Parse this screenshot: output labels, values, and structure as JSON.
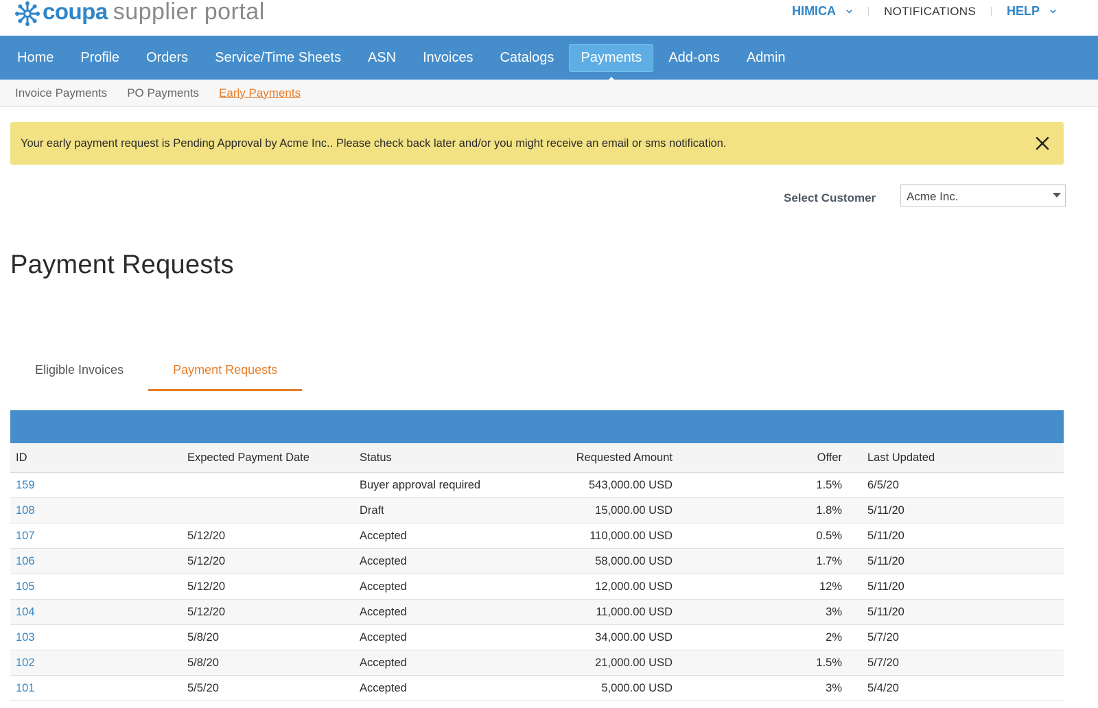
{
  "header": {
    "logo_brand": "coupa",
    "logo_product": "supplier portal",
    "user_menu": "HIMICA",
    "notifications": "NOTIFICATIONS",
    "help": "HELP"
  },
  "nav": {
    "items": [
      "Home",
      "Profile",
      "Orders",
      "Service/Time Sheets",
      "ASN",
      "Invoices",
      "Catalogs",
      "Payments",
      "Add-ons",
      "Admin"
    ],
    "active": "Payments"
  },
  "subnav": {
    "items": [
      "Invoice Payments",
      "PO Payments",
      "Early Payments"
    ],
    "active": "Early Payments"
  },
  "alert": {
    "message": "Your early payment request is Pending Approval by Acme Inc.. Please check back later and/or you might receive an email or sms notification."
  },
  "customer": {
    "label": "Select Customer",
    "selected": "Acme Inc."
  },
  "page_title": "Payment Requests",
  "tabs": {
    "items": [
      "Eligible Invoices",
      "Payment Requests"
    ],
    "active": "Payment Requests"
  },
  "table": {
    "columns": [
      "ID",
      "Expected Payment Date",
      "Status",
      "Requested Amount",
      "Offer",
      "Last Updated"
    ],
    "rows": [
      [
        "159",
        "",
        "Buyer approval required",
        "543,000.00 USD",
        "1.5%",
        "6/5/20"
      ],
      [
        "108",
        "",
        "Draft",
        "15,000.00 USD",
        "1.8%",
        "5/11/20"
      ],
      [
        "107",
        "5/12/20",
        "Accepted",
        "110,000.00 USD",
        "0.5%",
        "5/11/20"
      ],
      [
        "106",
        "5/12/20",
        "Accepted",
        "58,000.00 USD",
        "1.7%",
        "5/11/20"
      ],
      [
        "105",
        "5/12/20",
        "Accepted",
        "12,000.00 USD",
        "12%",
        "5/11/20"
      ],
      [
        "104",
        "5/12/20",
        "Accepted",
        "11,000.00 USD",
        "3%",
        "5/11/20"
      ],
      [
        "103",
        "5/8/20",
        "Accepted",
        "34,000.00 USD",
        "2%",
        "5/7/20"
      ],
      [
        "102",
        "5/8/20",
        "Accepted",
        "21,000.00 USD",
        "1.5%",
        "5/7/20"
      ],
      [
        "101",
        "5/5/20",
        "Accepted",
        "5,000.00 USD",
        "3%",
        "5/4/20"
      ]
    ]
  },
  "colors": {
    "brand_blue": "#458dcb",
    "link_blue": "#2f86c8",
    "accent_orange": "#e87d27",
    "alert_yellow": "#f2e283"
  }
}
